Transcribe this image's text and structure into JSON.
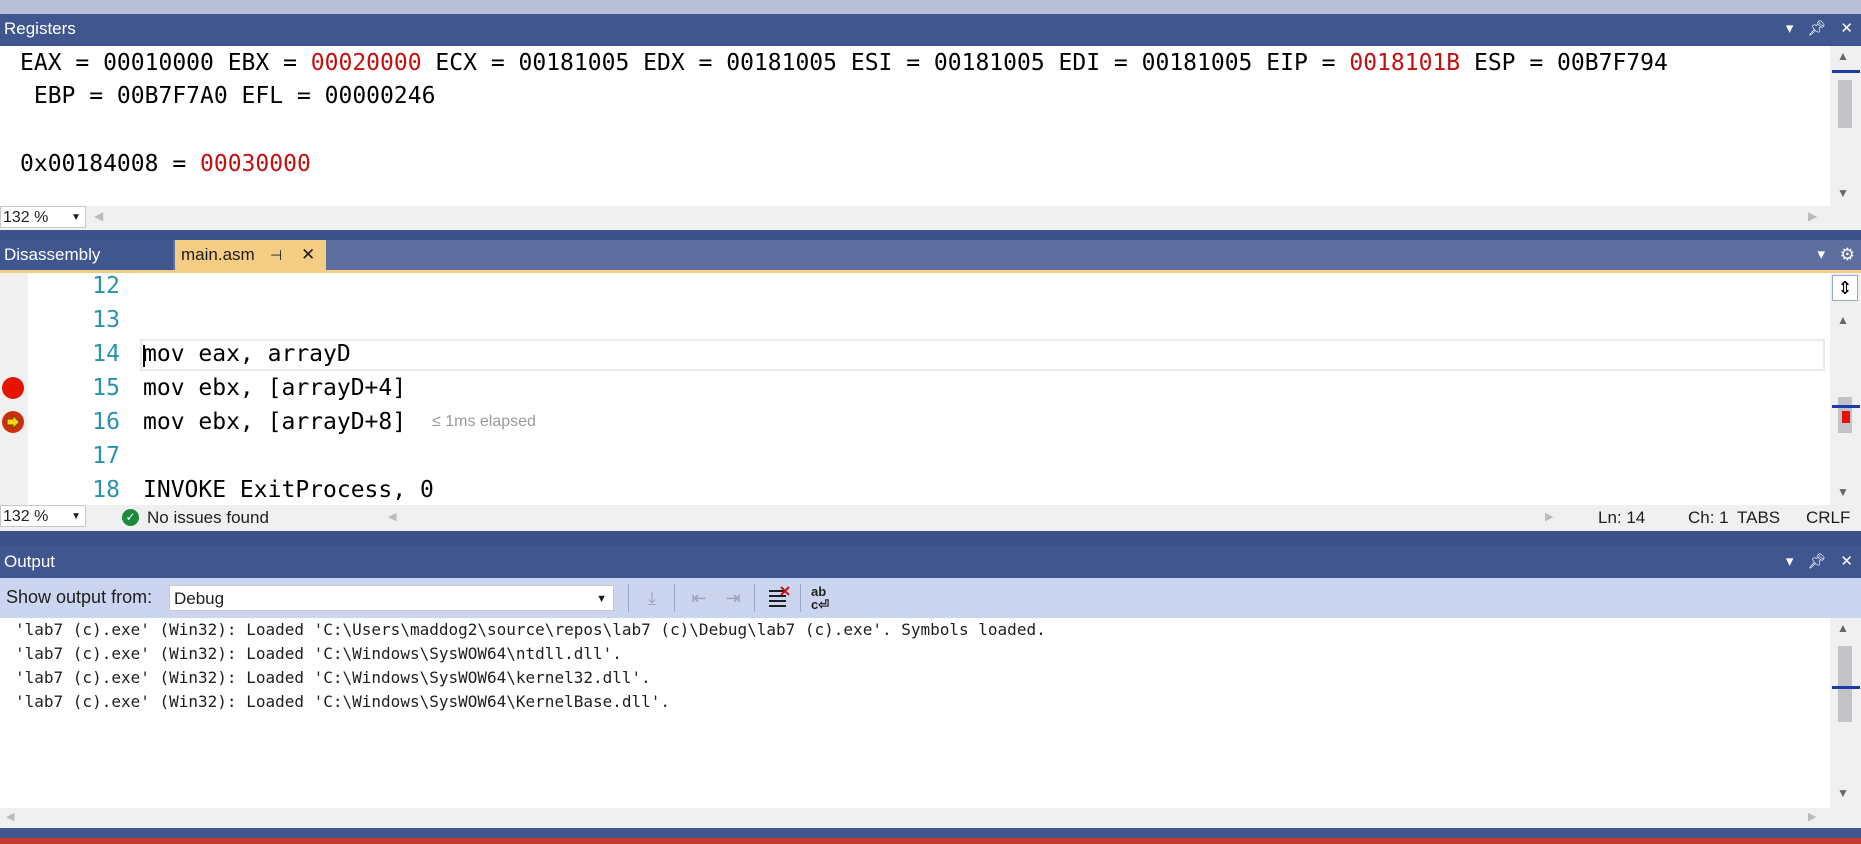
{
  "registers": {
    "title": "Registers",
    "line1": [
      {
        "text": "EAX = 00010000 EBX = ",
        "changed": false
      },
      {
        "text": "00020000",
        "changed": true
      },
      {
        "text": " ECX = 00181005 EDX = 00181005 ESI = 00181005 EDI = 00181005 EIP = ",
        "changed": false
      },
      {
        "text": "0018101B",
        "changed": true
      },
      {
        "text": " ESP = 00B7F794",
        "changed": false
      }
    ],
    "line2": " EBP = 00B7F7A0 EFL = 00000246",
    "mem_label": "0x00184008 = ",
    "mem_value": "00030000",
    "zoom": "132 %"
  },
  "editor": {
    "tabs": [
      {
        "label": "Disassembly",
        "active": false
      },
      {
        "label": "main.asm",
        "active": true
      }
    ],
    "lines": [
      {
        "num": "12",
        "code": ""
      },
      {
        "num": "13",
        "code": ""
      },
      {
        "num": "14",
        "code": "mov eax, arrayD"
      },
      {
        "num": "15",
        "code": "mov ebx, [arrayD+4]"
      },
      {
        "num": "16",
        "code": "mov ebx, [arrayD+8]"
      },
      {
        "num": "17",
        "code": ""
      },
      {
        "num": "18",
        "code": "INVOKE ExitProcess, 0"
      }
    ],
    "elapsed": "≤ 1ms elapsed",
    "zoom": "132 %",
    "issues": "No issues found",
    "status": {
      "ln": "Ln: 14",
      "ch": "Ch: 1",
      "tabs": "TABS",
      "eol": "CRLF"
    }
  },
  "output": {
    "title": "Output",
    "show_from_label": "Show output from:",
    "source": "Debug",
    "lines": [
      "'lab7 (c).exe' (Win32): Loaded 'C:\\Users\\maddog2\\source\\repos\\lab7 (c)\\Debug\\lab7 (c).exe'. Symbols loaded.",
      "'lab7 (c).exe' (Win32): Loaded 'C:\\Windows\\SysWOW64\\ntdll.dll'.",
      "'lab7 (c).exe' (Win32): Loaded 'C:\\Windows\\SysWOW64\\kernel32.dll'.",
      "'lab7 (c).exe' (Win32): Loaded 'C:\\Windows\\SysWOW64\\KernelBase.dll'."
    ]
  },
  "colors": {
    "title_bar": "#40568f",
    "tab_active": "#f5cc84",
    "changed_value": "#c50f0f",
    "line_number": "#2b91af",
    "breakpoint": "#e51400",
    "toolbar": "#ccd5f0"
  }
}
